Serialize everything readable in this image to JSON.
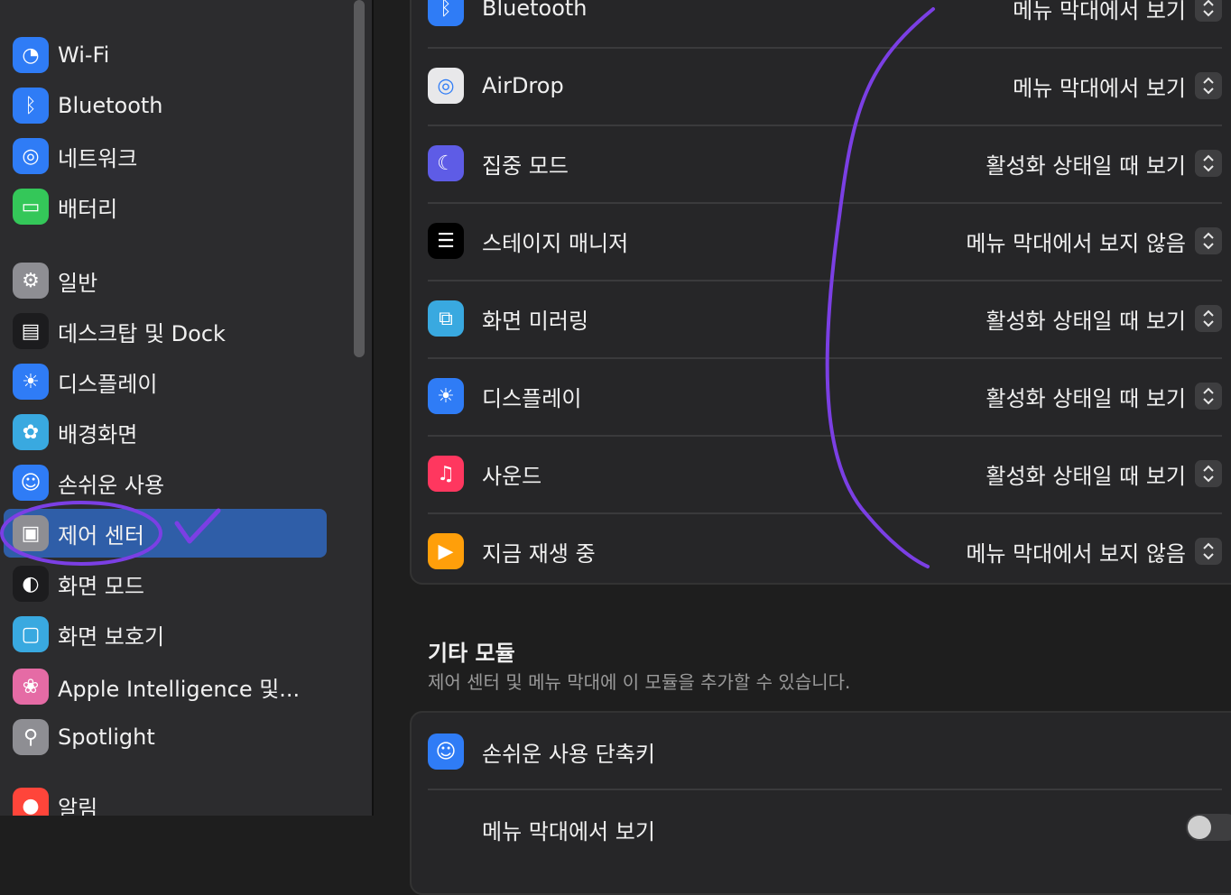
{
  "sidebar": {
    "items": [
      {
        "label": "Wi-Fi",
        "icon": "wifi-icon",
        "color": "#2f7cf6"
      },
      {
        "label": "Bluetooth",
        "icon": "bluetooth-icon",
        "color": "#2f7cf6"
      },
      {
        "label": "네트워크",
        "icon": "globe-icon",
        "color": "#2f7cf6"
      },
      {
        "label": "배터리",
        "icon": "battery-icon",
        "color": "#34c759"
      },
      {
        "label": "일반",
        "icon": "gear-icon",
        "color": "#8e8e93"
      },
      {
        "label": "데스크탑 및 Dock",
        "icon": "dock-icon",
        "color": "#1c1c1e"
      },
      {
        "label": "디스플레이",
        "icon": "sun-icon",
        "color": "#2f7cf6"
      },
      {
        "label": "배경화면",
        "icon": "flower-icon",
        "color": "#39a9e0"
      },
      {
        "label": "손쉬운 사용",
        "icon": "accessibility-icon",
        "color": "#2f7cf6"
      },
      {
        "label": "제어 센터",
        "icon": "control-center-icon",
        "color": "#8e8e93",
        "selected": true
      },
      {
        "label": "화면 모드",
        "icon": "appearance-icon",
        "color": "#1c1c1e"
      },
      {
        "label": "화면 보호기",
        "icon": "screensaver-icon",
        "color": "#39a9e0"
      },
      {
        "label": "Apple Intelligence 및...",
        "icon": "apple-intelligence-icon",
        "color": "#e56ba5"
      },
      {
        "label": "Spotlight",
        "icon": "magnifier-icon",
        "color": "#8e8e93"
      },
      {
        "label": "알림",
        "icon": "notification-icon",
        "color": "#ff453a"
      }
    ]
  },
  "modules": {
    "rows": [
      {
        "label": "Bluetooth",
        "value": "메뉴 막대에서 보기",
        "icon": "bluetooth-icon",
        "color": "#2f7cf6"
      },
      {
        "label": "AirDrop",
        "value": "메뉴 막대에서 보기",
        "icon": "airdrop-icon",
        "color": "#e8e8ea"
      },
      {
        "label": "집중 모드",
        "value": "활성화 상태일 때 보기",
        "icon": "moon-icon",
        "color": "#5e5ce6"
      },
      {
        "label": "스테이지 매니저",
        "value": "메뉴 막대에서 보지 않음",
        "icon": "stage-manager-icon",
        "color": "#000000"
      },
      {
        "label": "화면 미러링",
        "value": "활성화 상태일 때 보기",
        "icon": "screen-mirroring-icon",
        "color": "#39a9e0"
      },
      {
        "label": "디스플레이",
        "value": "활성화 상태일 때 보기",
        "icon": "sun-icon",
        "color": "#2f7cf6"
      },
      {
        "label": "사운드",
        "value": "활성화 상태일 때 보기",
        "icon": "speaker-icon",
        "color": "#ff375f"
      },
      {
        "label": "지금 재생 중",
        "value": "메뉴 막대에서 보지 않음",
        "icon": "play-icon",
        "color": "#ff9f0a"
      }
    ]
  },
  "other_modules": {
    "title": "기타 모듈",
    "subtitle": "제어 센터 및 메뉴 막대에 이 모듈을 추가할 수 있습니다.",
    "rows": [
      {
        "label": "손쉬운 사용 단축키",
        "icon": "accessibility-icon",
        "color": "#2f7cf6"
      },
      {
        "label": "메뉴 막대에서 보기",
        "icon": "",
        "color": ""
      }
    ]
  },
  "annotation": {
    "color": "#7b3fe4"
  }
}
